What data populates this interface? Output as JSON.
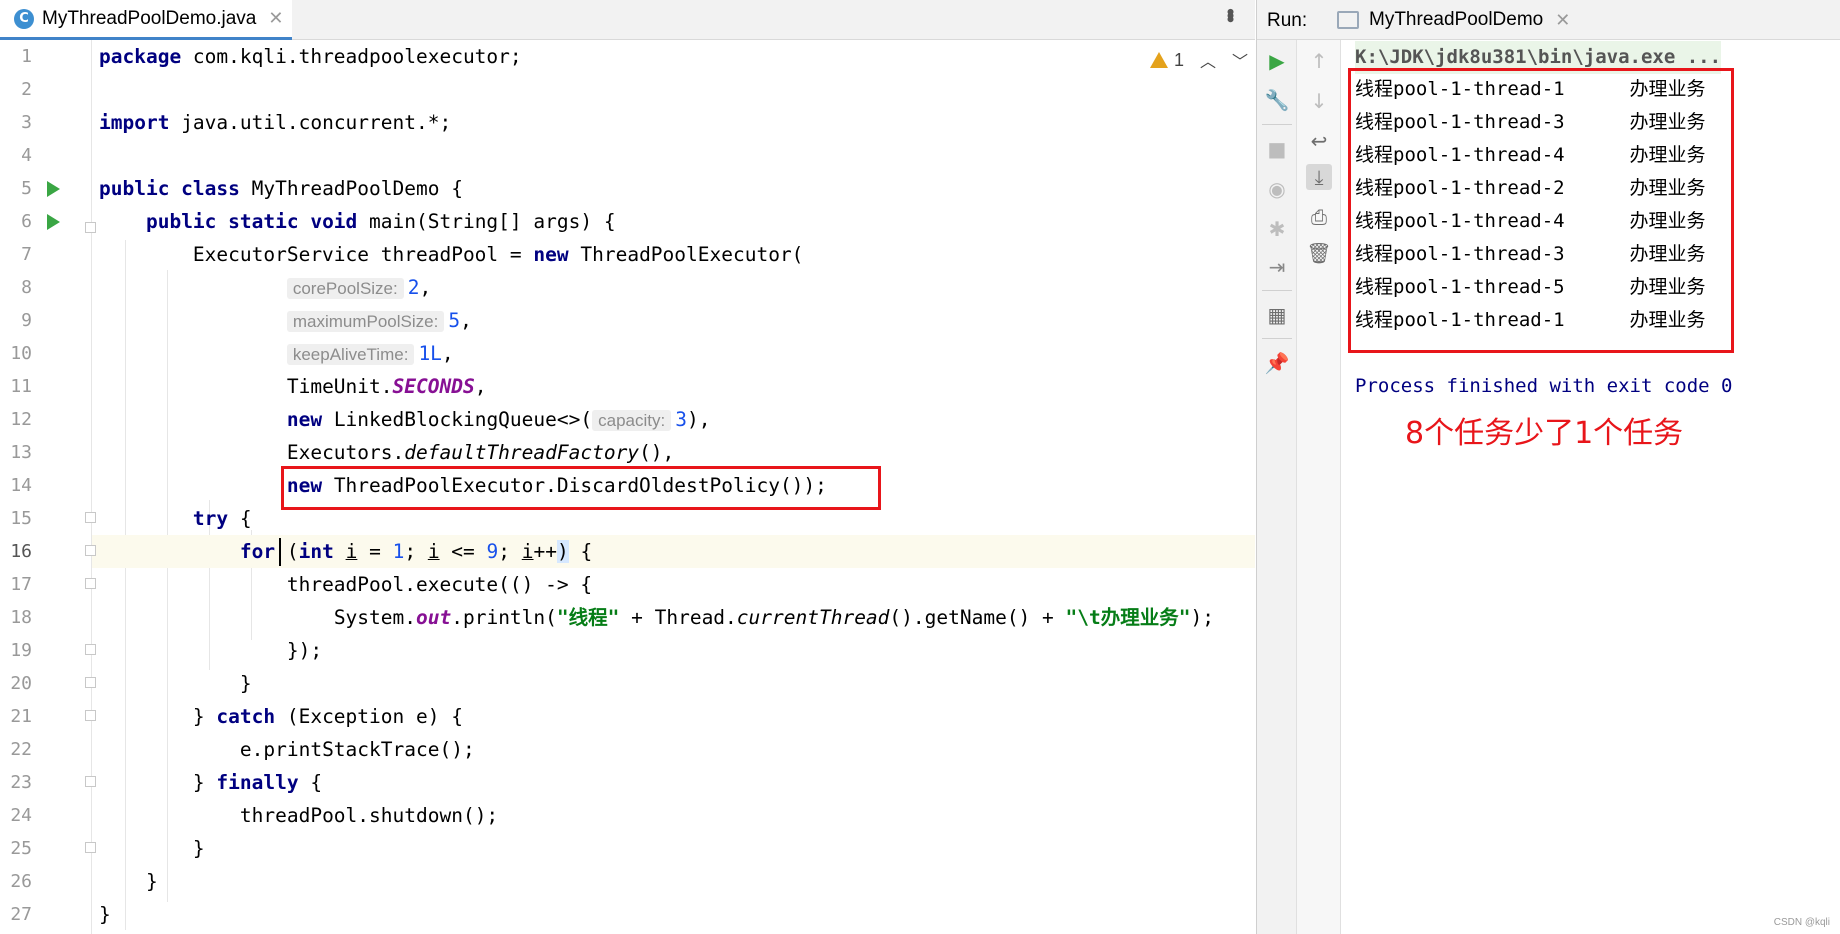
{
  "editor": {
    "tab_label": "MyThreadPoolDemo.java",
    "tab_icon": "java-class-icon",
    "warning_count": "1",
    "line_numbers": [
      "1",
      "2",
      "3",
      "4",
      "5",
      "6",
      "7",
      "8",
      "9",
      "10",
      "11",
      "12",
      "13",
      "14",
      "15",
      "16",
      "17",
      "18",
      "19",
      "20",
      "21",
      "22",
      "23",
      "24",
      "25",
      "26",
      "27"
    ],
    "code": {
      "l1_kw": "package",
      "l1_rest": " com.kqli.threadpoolexecutor;",
      "l3_kw": "import",
      "l3_rest": " java.util.concurrent.*;",
      "l5_kw": "public class",
      "l5_rest": " MyThreadPoolDemo {",
      "l6_kw": "public static void",
      "l6_rest": " main(String[] args) {",
      "l7_a": "ExecutorService threadPool = ",
      "l7_kw": "new",
      "l7_b": " ThreadPoolExecutor(",
      "l8_hint": "corePoolSize:",
      "l8_num": "2",
      "l8_tail": ",",
      "l9_hint": "maximumPoolSize:",
      "l9_num": "5",
      "l9_tail": ",",
      "l10_hint": "keepAliveTime:",
      "l10_num": "1L",
      "l10_tail": ",",
      "l11_a": "TimeUnit.",
      "l11_const": "SECONDS",
      "l11_tail": ",",
      "l12_kw": "new",
      "l12_a": " LinkedBlockingQueue<>(",
      "l12_hint": "capacity:",
      "l12_num": "3",
      "l12_tail": "),",
      "l13_a": "Executors.",
      "l13_it": "defaultThreadFactory",
      "l13_tail": "(),",
      "l14_kw": "new",
      "l14_rest": " ThreadPoolExecutor.DiscardOldestPolicy());",
      "l15_kw": "try",
      "l15_rest": " {",
      "l16_kw": "for",
      "l16_p1": " (",
      "l16_kw2": "int",
      "l16_i1": "i",
      "l16_m1": " = ",
      "l16_n1": "1",
      "l16_m2": "; ",
      "l16_i2": "i",
      "l16_m3": " <= ",
      "l16_n2": "9",
      "l16_m4": "; ",
      "l16_i3": "i",
      "l16_m5": "++",
      "l16_p2": ")",
      "l16_tail": " {",
      "l17": "threadPool.execute(() -> {",
      "l18_a": "System.",
      "l18_field": "out",
      "l18_b": ".println(",
      "l18_s1": "\"线程\"",
      "l18_c": " + Thread.",
      "l18_it": "currentThread",
      "l18_d": "().getName() + ",
      "l18_s2": "\"\\t办理业务\"",
      "l18_e": ");",
      "l19": "});",
      "l20": "}",
      "l21_a": "} ",
      "l21_kw": "catch",
      "l21_b": " (Exception e) {",
      "l22": "e.printStackTrace();",
      "l23_a": "} ",
      "l23_kw": "finally",
      "l23_b": " {",
      "l24": "threadPool.shutdown();",
      "l25": "}",
      "l26": "}",
      "l27": "}"
    }
  },
  "run_panel": {
    "label": "Run:",
    "tab_label": "MyThreadPoolDemo",
    "command": "K:\\JDK\\jdk8u381\\bin\\java.exe ...",
    "output": [
      "线程pool-1-thread-1\t办理业务",
      "线程pool-1-thread-3\t办理业务",
      "线程pool-1-thread-4\t办理业务",
      "线程pool-1-thread-2\t办理业务",
      "线程pool-1-thread-4\t办理业务",
      "线程pool-1-thread-3\t办理业务",
      "线程pool-1-thread-5\t办理业务",
      "线程pool-1-thread-1\t办理业务"
    ],
    "finish": "Process finished with exit code 0",
    "annotation": "8个任务少了1个任务",
    "watermark": "CSDN @kqli"
  },
  "colors": {
    "highlight_red": "#e8151a",
    "keyword": "#000080",
    "number": "#1750eb",
    "string": "#067d17",
    "run_green": "#3aa644"
  }
}
